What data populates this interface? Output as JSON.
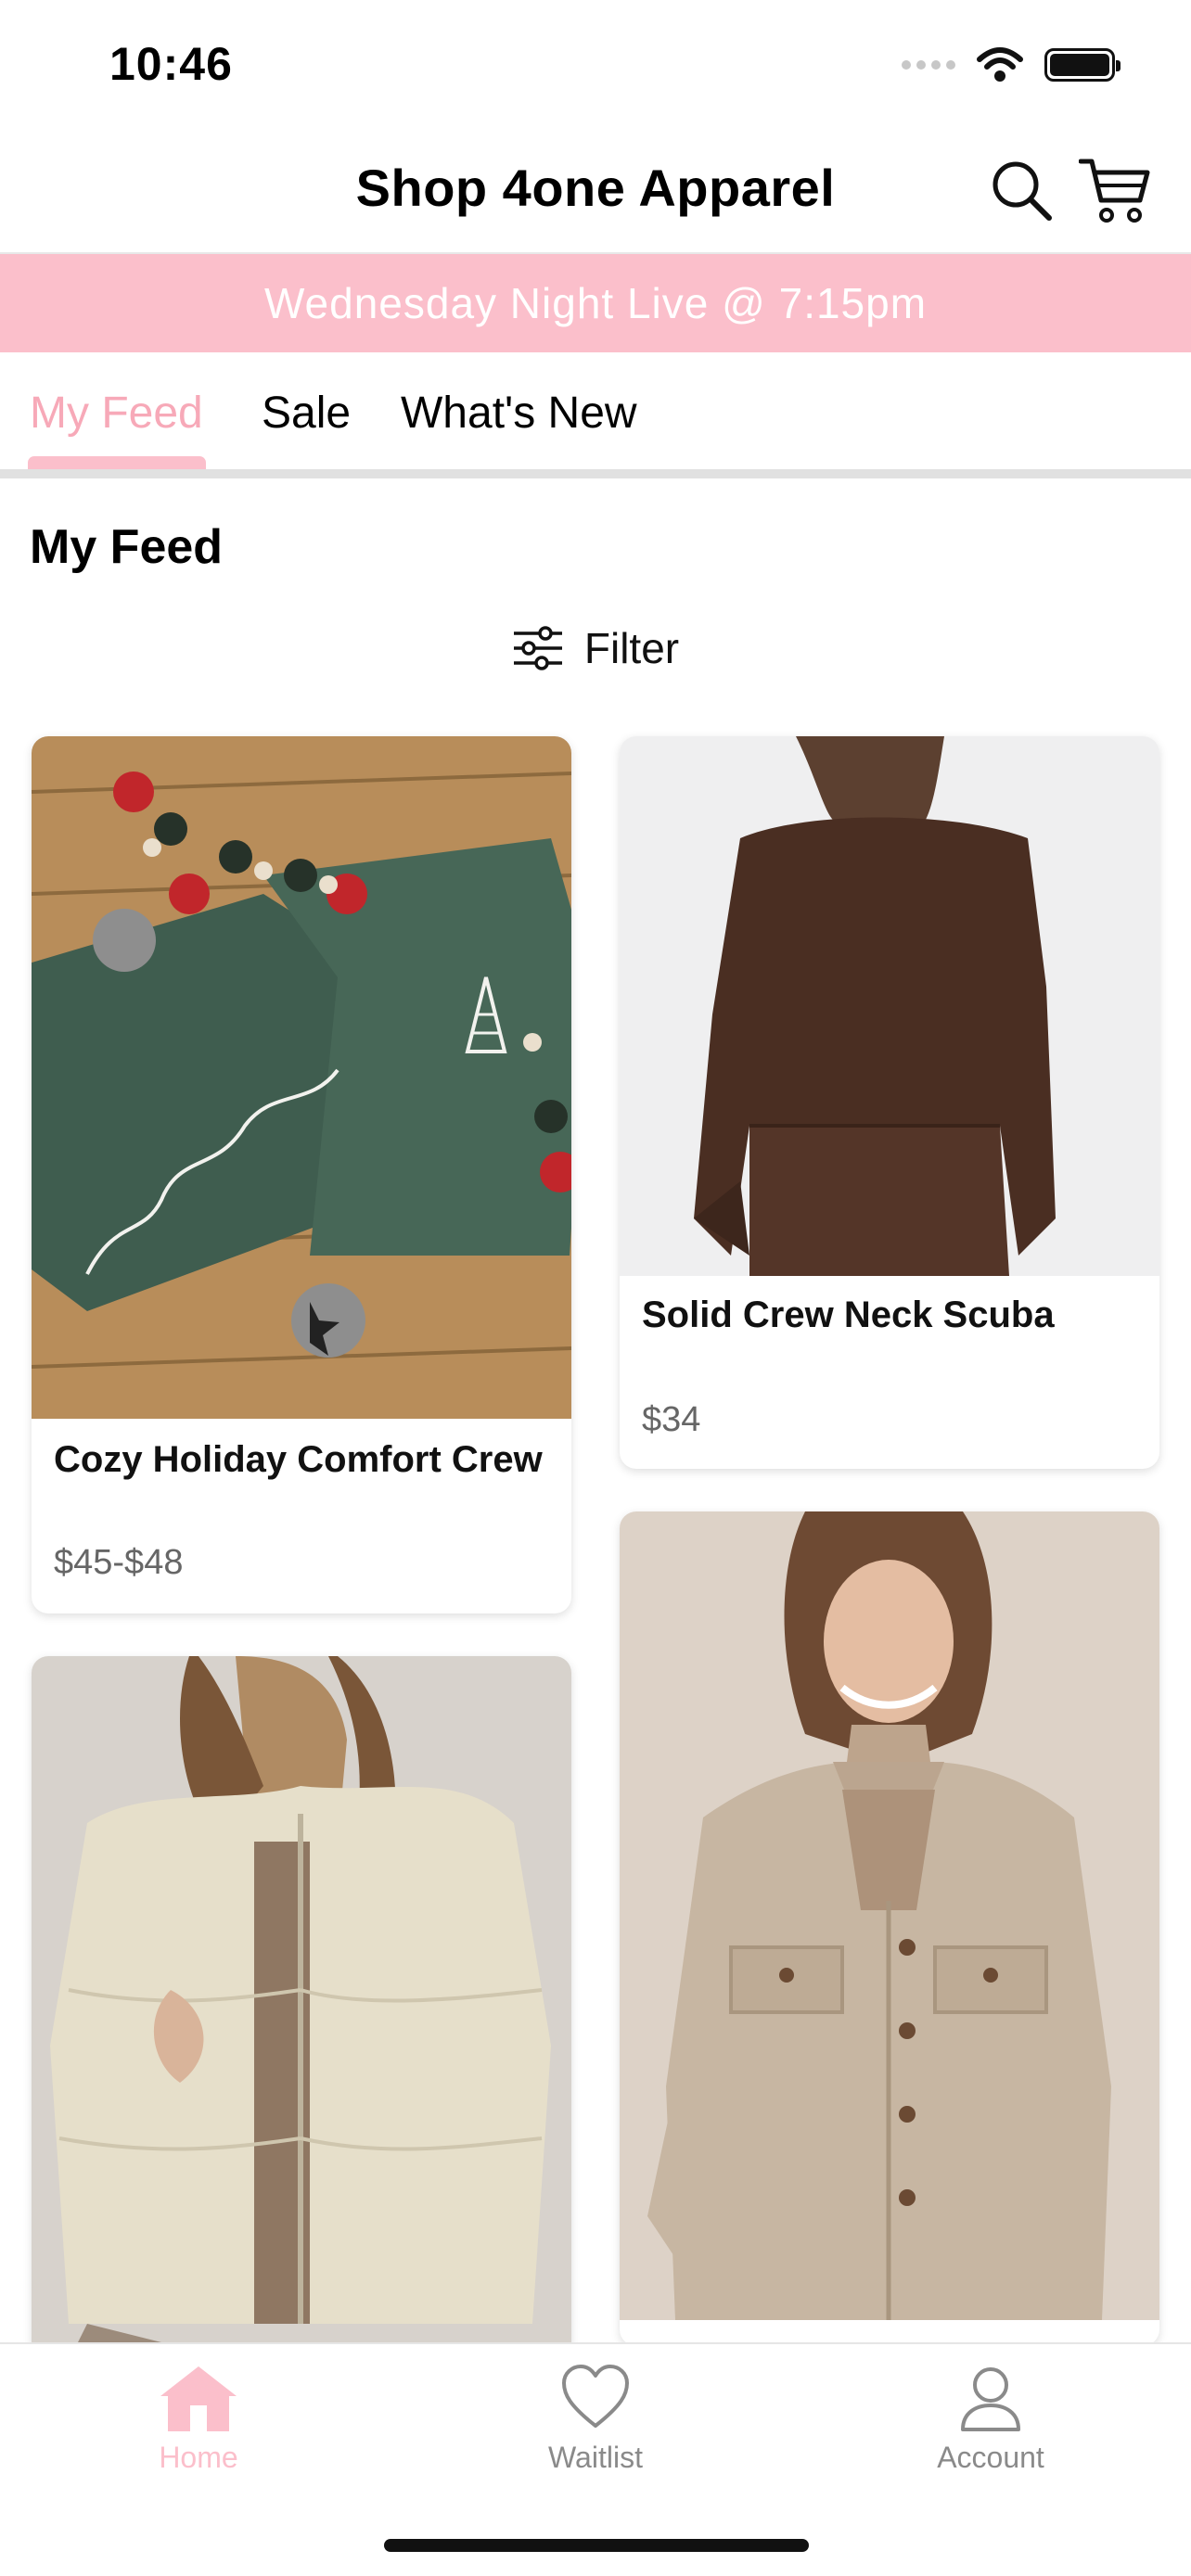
{
  "status_bar": {
    "time": "10:46",
    "icons": [
      "signal-icon",
      "wifi-icon",
      "battery-icon"
    ]
  },
  "header": {
    "title": "Shop 4one Apparel",
    "icons": [
      "search-icon",
      "cart-icon"
    ]
  },
  "banner": {
    "text": "Wednesday Night Live @ 7:15pm",
    "background": "#fbbfcb"
  },
  "tabs": [
    {
      "label": "My Feed",
      "active": true
    },
    {
      "label": "Sale",
      "active": false
    },
    {
      "label": "What's New",
      "active": false
    }
  ],
  "feed": {
    "title": "My Feed",
    "filter_label": "Filter",
    "filter_icon": "sliders-icon"
  },
  "products": [
    {
      "name": "Cozy Holiday Comfort Crew",
      "price": "$45-$48",
      "image": "green holiday sweatshirts with Merry & Bright script"
    },
    {
      "name": "Solid Crew Neck Scuba",
      "price": "$34",
      "image": "brown crew neck sweatshirt back view"
    },
    {
      "name": "",
      "price": "",
      "image": "cream puffer jacket"
    },
    {
      "name": "",
      "price": "",
      "image": "taupe shacket with buttons"
    }
  ],
  "bottom_nav": [
    {
      "label": "Home",
      "icon": "home-icon",
      "active": true
    },
    {
      "label": "Waitlist",
      "icon": "heart-icon",
      "active": false
    },
    {
      "label": "Account",
      "icon": "user-icon",
      "active": false
    }
  ],
  "colors": {
    "accent": "#fbbfcb",
    "active_tab": "#f7a9b8",
    "inactive_nav": "#8a8a8a"
  }
}
